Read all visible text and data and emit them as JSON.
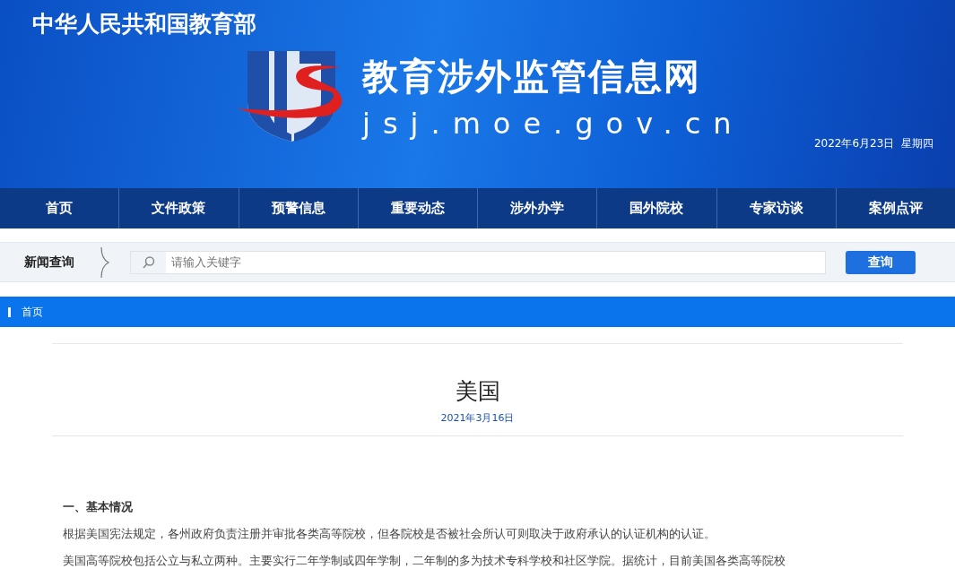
{
  "header": {
    "ministry": "中华人民共和国教育部",
    "site_title": "教育涉外监管信息网",
    "site_url": "jsj.moe.gov.cn",
    "date": "2022年6月23日  星期四"
  },
  "nav": [
    {
      "label": "首页"
    },
    {
      "label": "文件政策"
    },
    {
      "label": "预警信息"
    },
    {
      "label": "重要动态"
    },
    {
      "label": "涉外办学"
    },
    {
      "label": "国外院校"
    },
    {
      "label": "专家访谈"
    },
    {
      "label": "案例点评"
    }
  ],
  "search": {
    "label": "新闻查询",
    "placeholder": "请输入关键字",
    "button": "查询"
  },
  "breadcrumb": {
    "label": "首页"
  },
  "article": {
    "title": "美国",
    "date": "2021年3月16日",
    "heading": "一、基本情况",
    "paragraphs": [
      "根据美国宪法规定，各州政府负责注册并审批各类高等院校，但各院校是否被社会所认可则取决于政府承认的认证机构的认证。",
      "美国高等院校包括公立与私立两种。主要实行二年学制或四年学制，二年制的多为技术专科学校和社区学院。据统计，目前美国各类高等院校"
    ]
  }
}
